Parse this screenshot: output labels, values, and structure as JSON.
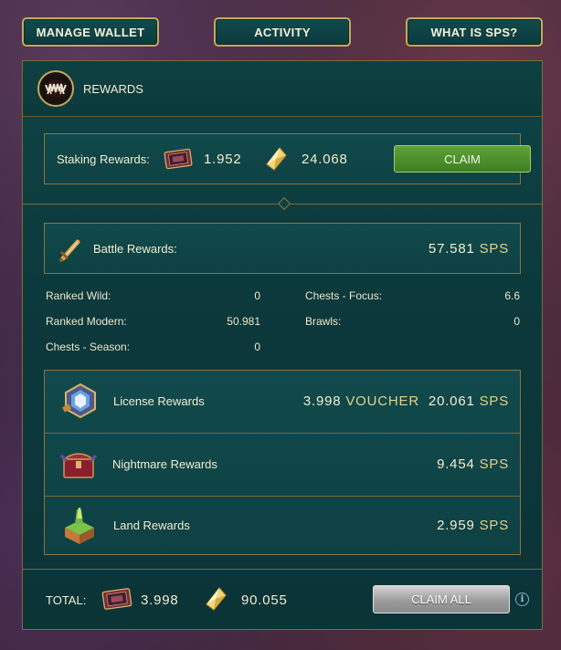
{
  "nav": {
    "manage_wallet": "MANAGE WALLET",
    "activity": "ACTIVITY",
    "what_is_sps": "WHAT IS SPS?"
  },
  "panel": {
    "title": "REWARDS",
    "emblem_icon": "fanged-mouth-icon"
  },
  "staking": {
    "label": "Staking Rewards:",
    "voucher_value": "1.952",
    "sps_value": "24.068",
    "voucher_icon": "voucher-card-icon",
    "sps_icon": "sps-crystal-icon",
    "claim_label": "CLAIM"
  },
  "battle": {
    "label": "Battle Rewards:",
    "value": "57.581",
    "unit": "SPS",
    "icon": "sword-icon",
    "stats_left": [
      {
        "label": "Ranked Wild:",
        "value": "0"
      },
      {
        "label": "Ranked Modern:",
        "value": "50.981"
      },
      {
        "label": "Chests - Season:",
        "value": "0"
      }
    ],
    "stats_right": [
      {
        "label": "Chests - Focus:",
        "value": "6.6"
      },
      {
        "label": "Brawls:",
        "value": "0"
      }
    ]
  },
  "license": {
    "label": "License Rewards",
    "voucher_value": "3.998",
    "voucher_unit": "VOUCHER",
    "sps_value": "20.061",
    "sps_unit": "SPS",
    "icon": "license-badge-icon"
  },
  "nightmare": {
    "label": "Nightmare Rewards",
    "value": "9.454",
    "unit": "SPS",
    "icon": "nightmare-chest-icon"
  },
  "land": {
    "label": "Land Rewards",
    "value": "2.959",
    "unit": "SPS",
    "icon": "land-plot-icon"
  },
  "total": {
    "label": "TOTAL:",
    "voucher_value": "3.998",
    "sps_value": "90.055",
    "claim_all_label": "CLAIM ALL",
    "info_glyph": "i"
  },
  "colors": {
    "panel_bg": "#0e3f42",
    "gold_border": "#c7a75b",
    "claim_green": "#4f9230",
    "claim_all_gray": "#a8a8a8",
    "unit_gold": "#e4d08a"
  }
}
